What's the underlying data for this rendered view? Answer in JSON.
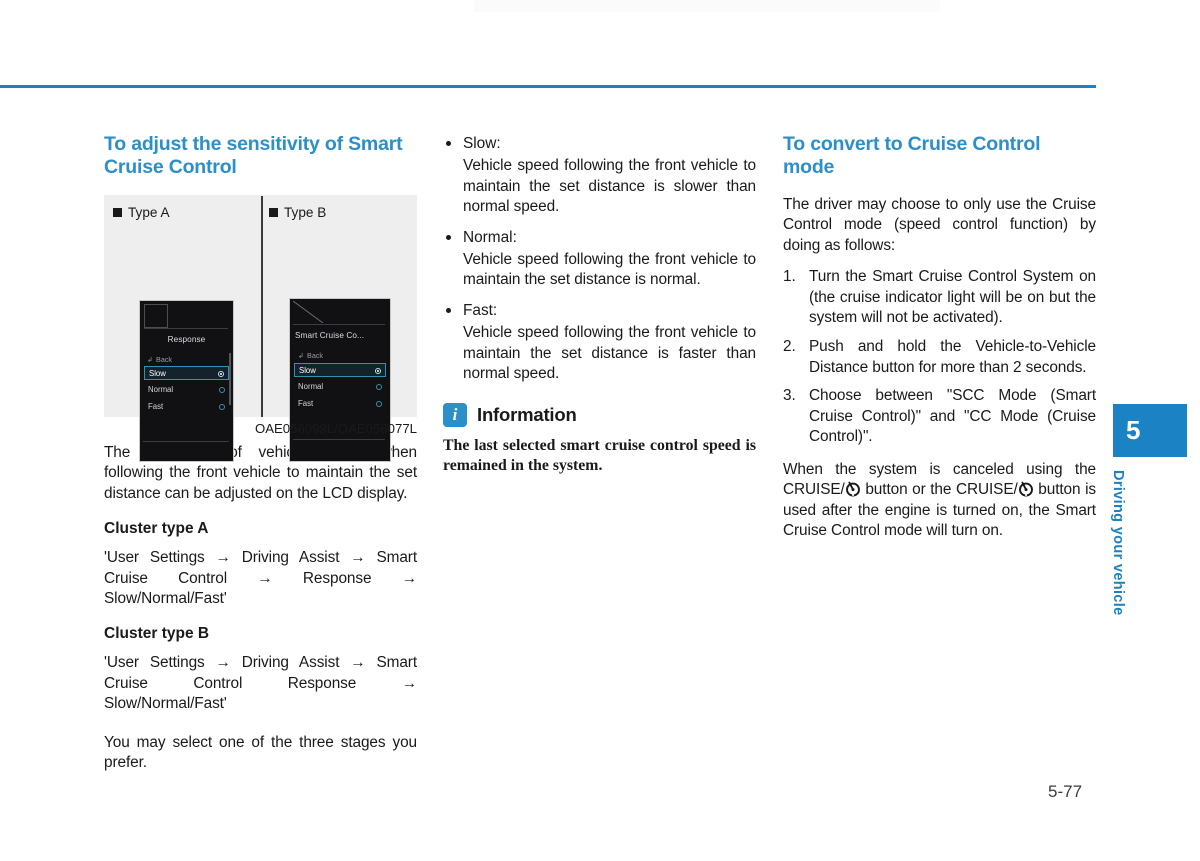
{
  "page": {
    "number": "5-77",
    "accent_color": "#2b8fc9",
    "rule_color": "#1b82c4"
  },
  "side_tab": {
    "chapter_number": "5",
    "chapter_label": "Driving your vehicle"
  },
  "column_left": {
    "heading": "To adjust the sensitivity of Smart Cruise Control",
    "figure": {
      "label_a": "Type A",
      "label_b": "Type B",
      "caption": "OAE056099L/OAE056077L",
      "cluster_a": {
        "title": "Response",
        "back_label": "Back",
        "options": [
          {
            "label": "Slow",
            "selected": true
          },
          {
            "label": "Normal",
            "selected": false
          },
          {
            "label": "Fast",
            "selected": false
          }
        ]
      },
      "cluster_b": {
        "title": "Smart Cruise Co...",
        "back_label": "Back",
        "options": [
          {
            "label": "Slow",
            "selected": true
          },
          {
            "label": "Normal",
            "selected": false
          },
          {
            "label": "Fast",
            "selected": false
          }
        ]
      }
    },
    "intro": "The sensitivity of vehicle speed when following the front vehicle to maintain the set distance can be adjusted on the LCD display.",
    "cluster_a_heading": "Cluster type A",
    "cluster_a_path": "'User Settings → Driving Assist → Smart Cruise Control → Response → Slow/Normal/Fast'",
    "cluster_b_heading": "Cluster type B",
    "cluster_b_path": "'User Settings → Driving Assist → Smart Cruise Control Response → Slow/Normal/Fast'",
    "closing": "You may select one of the three stages you prefer."
  },
  "column_middle": {
    "bullets": [
      {
        "title": "Slow:",
        "body": "Vehicle speed following the front vehicle to maintain the set distance is slower than normal speed."
      },
      {
        "title": "Normal:",
        "body": "Vehicle speed following the front vehicle to maintain the set distance is normal."
      },
      {
        "title": "Fast:",
        "body": "Vehicle speed following the front vehicle to maintain the set distance is faster than normal speed."
      }
    ],
    "information": {
      "icon_letter": "i",
      "title": "Information",
      "text": "The last selected smart cruise control speed is remained in the system."
    }
  },
  "column_right": {
    "heading": "To convert to Cruise Control mode",
    "intro": "The driver may choose to only use the Cruise Control mode (speed control function) by doing as follows:",
    "steps": [
      {
        "number": "1.",
        "text": "Turn the Smart Cruise Control System on (the cruise indicator light will be on but the system will not be activated)."
      },
      {
        "number": "2.",
        "text": "Push and hold the Vehicle-to-Vehicle Distance button for more than 2 seconds."
      },
      {
        "number": "3.",
        "text": "Choose between \"SCC Mode (Smart Cruise Control)\" and \"CC Mode (Cruise Control)\"."
      }
    ],
    "closing": {
      "part1": "When the system is canceled using the CRUISE/",
      "part2": " button or the CRUISE/",
      "part3": " button is used after the engine is turned on, the Smart Cruise Control mode will turn on."
    }
  }
}
